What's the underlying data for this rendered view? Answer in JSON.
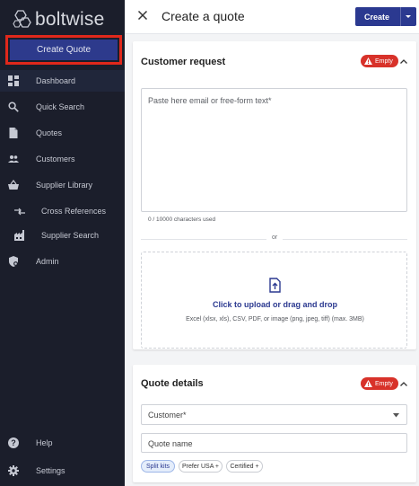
{
  "brand": {
    "name": "boltwise"
  },
  "sidebar": {
    "create_label": "Create Quote",
    "items": [
      {
        "label": "Dashboard",
        "icon": "dashboard-icon"
      },
      {
        "label": "Quick Search",
        "icon": "search-icon"
      },
      {
        "label": "Quotes",
        "icon": "document-icon"
      },
      {
        "label": "Customers",
        "icon": "people-icon"
      },
      {
        "label": "Supplier Library",
        "icon": "basket-icon"
      },
      {
        "label": "Cross References",
        "icon": "swap-arrows-icon"
      },
      {
        "label": "Supplier Search",
        "icon": "factory-icon"
      },
      {
        "label": "Admin",
        "icon": "admin-shield-icon"
      }
    ],
    "footer": [
      {
        "label": "Help",
        "icon": "help-icon"
      },
      {
        "label": "Settings",
        "icon": "gear-icon"
      }
    ]
  },
  "header": {
    "title": "Create a quote",
    "primary_label": "Create"
  },
  "customer_request": {
    "title": "Customer request",
    "badge": "Empty",
    "placeholder": "Paste here email or free-form text*",
    "counter": "0 / 10000 characters used",
    "or": "or",
    "upload_title": "Click to upload or drag and drop",
    "upload_hint": "Excel (xlsx, xls), CSV, PDF, or image (png, jpeg, tiff) (max. 3MB)"
  },
  "quote_details": {
    "title": "Quote details",
    "badge": "Empty",
    "customer_placeholder": "Customer*",
    "name_placeholder": "Quote name",
    "chips": [
      "Split kits",
      "Prefer USA +",
      "Certified +"
    ]
  },
  "colors": {
    "sidebar_bg": "#1b1e2b",
    "accent": "#2b3990",
    "danger": "#d8322a",
    "highlight_border": "#e0281b"
  }
}
